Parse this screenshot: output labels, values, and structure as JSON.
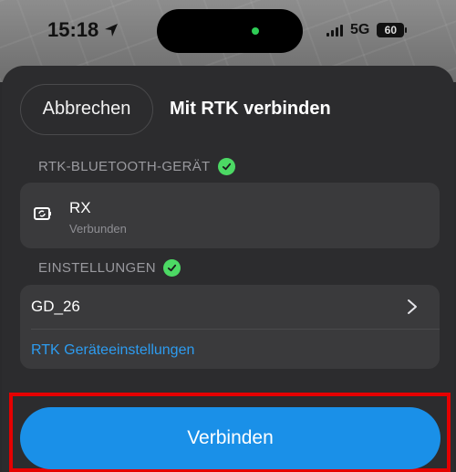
{
  "status_bar": {
    "time": "15:18",
    "network": "5G",
    "battery": "60"
  },
  "sheet": {
    "cancel_label": "Abbrechen",
    "title": "Mit RTK verbinden"
  },
  "bluetooth_section": {
    "header": "RTK-BLUETOOTH-GERÄT",
    "device_name": "RX",
    "device_status": "Verbunden"
  },
  "settings_section": {
    "header": "EINSTELLUNGEN",
    "item_name": "GD_26",
    "link_label": "RTK Geräteeinstellungen"
  },
  "actions": {
    "connect_label": "Verbinden"
  },
  "colors": {
    "accent": "#1a90e8",
    "success": "#4cd964",
    "highlight": "#e50000",
    "link": "#2d9cf0"
  }
}
